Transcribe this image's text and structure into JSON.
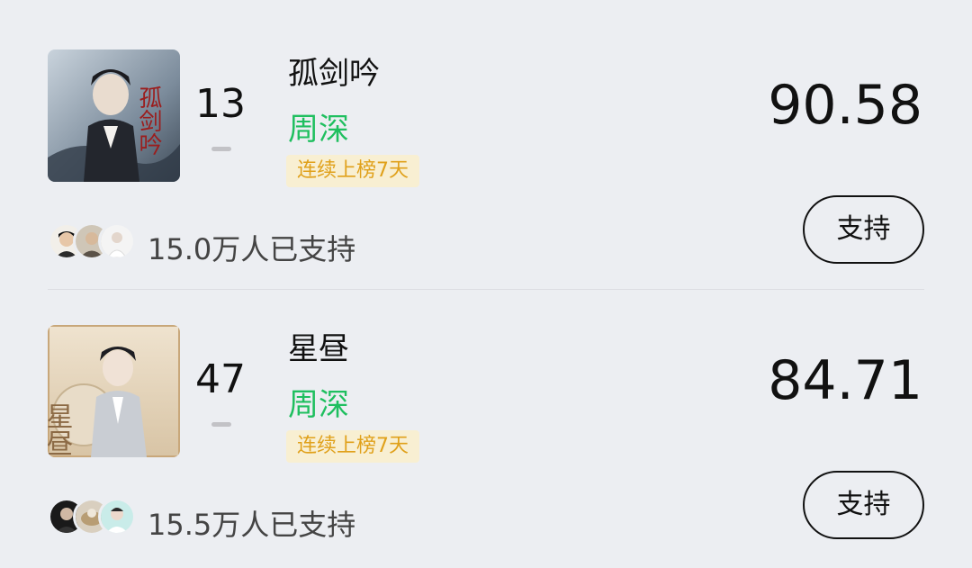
{
  "entries": [
    {
      "rank": "13",
      "title": "孤剑吟",
      "artist": "周深",
      "streak": "连续上榜7天",
      "score": "90.58",
      "supporters": "15.0万人已支持",
      "support_label": "支持",
      "cover_text": "孤剑吟"
    },
    {
      "rank": "47",
      "title": "星昼",
      "artist": "周深",
      "streak": "连续上榜7天",
      "score": "84.71",
      "supporters": "15.5万人已支持",
      "support_label": "支持",
      "cover_text": "星昼"
    }
  ],
  "colors": {
    "background": "#eceef2",
    "artist": "#1fbf5f",
    "streak_text": "#e0a11b",
    "streak_bg": "#f8efd2"
  }
}
